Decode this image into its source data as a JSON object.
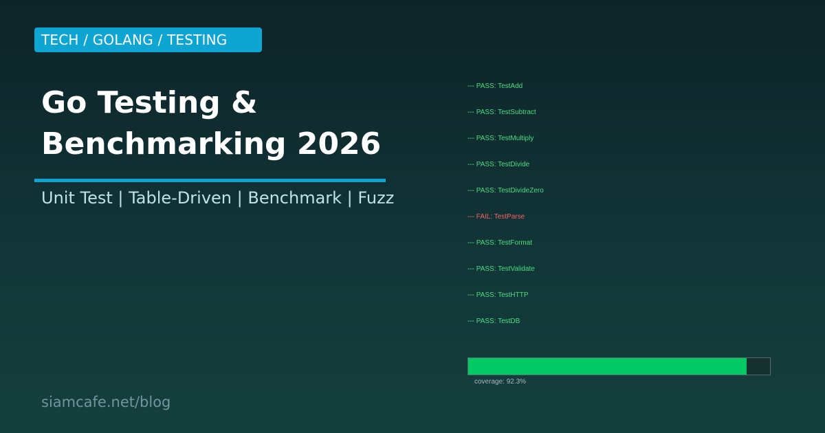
{
  "badge": {
    "label": "TECH / GOLANG / TESTING"
  },
  "title": {
    "line1": "Go Testing &",
    "line2": "Benchmarking 2026"
  },
  "subtitle": "Unit Test | Table-Driven | Benchmark | Fuzz",
  "site": "siamcafe.net/blog",
  "tests": [
    {
      "text": "--- PASS: TestAdd",
      "status": "pass"
    },
    {
      "text": "--- PASS: TestSubtract",
      "status": "pass"
    },
    {
      "text": "--- PASS: TestMultiply",
      "status": "pass"
    },
    {
      "text": "--- PASS: TestDivide",
      "status": "pass"
    },
    {
      "text": "--- PASS: TestDivideZero",
      "status": "pass"
    },
    {
      "text": "--- FAIL: TestParse",
      "status": "fail"
    },
    {
      "text": "--- PASS: TestFormat",
      "status": "pass"
    },
    {
      "text": "--- PASS: TestValidate",
      "status": "pass"
    },
    {
      "text": "--- PASS: TestHTTP",
      "status": "pass"
    },
    {
      "text": "--- PASS: TestDB",
      "status": "pass"
    }
  ],
  "coverage": {
    "label": "coverage: 92.3%",
    "percent": 92.3
  },
  "colors": {
    "accent": "#0ea5d2",
    "pass": "#4ade80",
    "fail": "#f26363",
    "coverage_fill": "#00c865"
  }
}
